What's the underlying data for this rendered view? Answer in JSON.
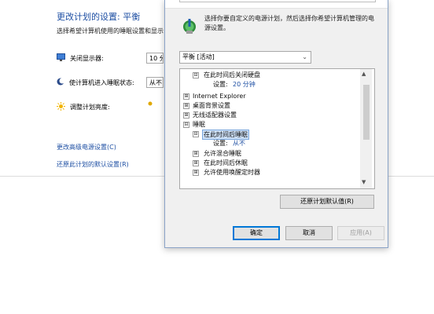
{
  "background_panel": {
    "title": "更改计划的设置: 平衡",
    "subtitle": "选择希望计算机使用的睡眠设置和显示",
    "rows": [
      {
        "icon": "monitor-icon",
        "label": "关闭显示器:",
        "value": "10 分"
      },
      {
        "icon": "moon-sleep-icon",
        "label": "使计算机进入睡眠状态:",
        "value": "从不"
      },
      {
        "icon": "brightness-icon",
        "label": "调整计划亮度:",
        "value": ""
      }
    ],
    "links": {
      "advanced": "更改高级电源设置(C)",
      "restore_defaults": "还原此计划的默认设置(R)"
    }
  },
  "dialog": {
    "intro_text": "选择你要自定义的电源计划，然后选择你希望计算机管理的电源设置。",
    "plan_select_value": "平衡 [活动]",
    "tree": [
      {
        "label": "在此时间后关闭硬盘",
        "state": "expanded",
        "level": 1
      },
      {
        "label": "设置: 20 分钟",
        "state": "setting",
        "level": 2,
        "prefix": "设置: ",
        "value": "20 分钟"
      },
      {
        "label": "Internet Explorer",
        "state": "collapsed",
        "level": 0
      },
      {
        "label": "桌面背景设置",
        "state": "collapsed",
        "level": 0
      },
      {
        "label": "无线适配器设置",
        "state": "collapsed",
        "level": 0
      },
      {
        "label": "睡眠",
        "state": "expanded",
        "level": 0
      },
      {
        "label": "在此时间后睡眠",
        "state": "expanded",
        "level": 1,
        "selected": true
      },
      {
        "label": "设置: 从不",
        "state": "setting",
        "level": 2,
        "prefix": "设置: ",
        "value": "从不"
      },
      {
        "label": "允许混合睡眠",
        "state": "collapsed",
        "level": 1
      },
      {
        "label": "在此时间后休眠",
        "state": "collapsed",
        "level": 1
      },
      {
        "label": "允许使用唤醒定时器",
        "state": "collapsed",
        "level": 1
      }
    ],
    "restore_button": "还原计划默认值(R)",
    "ok_button": "确定",
    "cancel_button": "取消",
    "apply_button": "应用(A)"
  },
  "icons": {
    "expand": "⊞",
    "collapse": "⊟",
    "chevron": "⌄",
    "scroll_up": "▲",
    "scroll_down": "▼"
  }
}
